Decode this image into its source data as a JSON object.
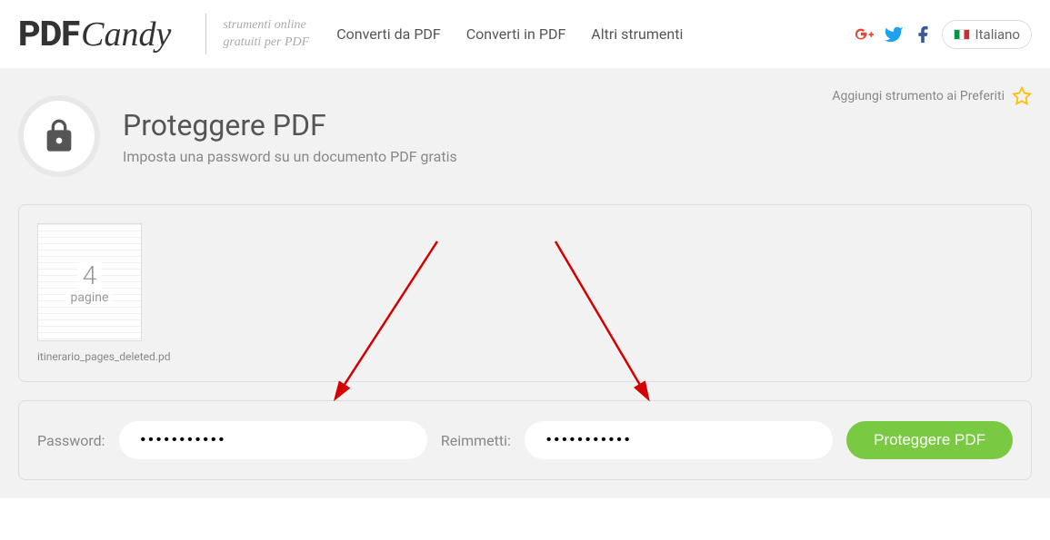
{
  "header": {
    "logo_pdf": "PDF",
    "logo_candy": "Candy",
    "tagline_line1": "strumenti online",
    "tagline_line2": "gratuiti per PDF"
  },
  "nav": {
    "item1": "Converti da PDF",
    "item2": "Converti in PDF",
    "item3": "Altri strumenti"
  },
  "lang": {
    "label": "Italiano"
  },
  "favorites": {
    "label": "Aggiungi strumento ai Preferiti"
  },
  "page": {
    "title": "Proteggere PDF",
    "subtitle": "Imposta una password su un documento PDF gratis"
  },
  "file": {
    "page_count": "4",
    "page_label": "pagine",
    "filename": "itinerario_pages_deleted.pd"
  },
  "form": {
    "password_label": "Password:",
    "reenter_label": "Reimmetti:",
    "password_value": "•••••••••••",
    "reenter_value": "•••••••••••",
    "submit_label": "Proteggere PDF"
  }
}
